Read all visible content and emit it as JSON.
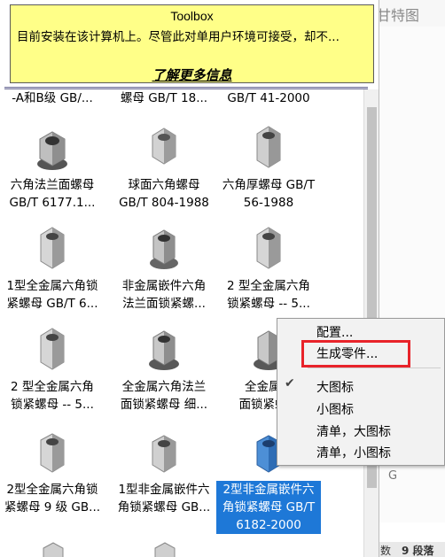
{
  "background_app": {
    "top_right_text": "甘特图",
    "side_letter": "G",
    "status_left": "数",
    "status_right": "9 段落"
  },
  "tooltip": {
    "title": "Toolbox",
    "description": "目前安装在该计算机上。尽管此对单用户环境可接受，却不...",
    "link": "了解更多信息"
  },
  "grid": {
    "items": [
      {
        "line1": "-A和B级 GB/...",
        "line2": ""
      },
      {
        "line1": "螺母 GB/T 18...",
        "line2": ""
      },
      {
        "line1": "GB/T 41-2000",
        "line2": ""
      },
      {
        "line1": "六角法兰面螺母",
        "line2": "GB/T 6177.1..."
      },
      {
        "line1": "球面六角螺母",
        "line2": "GB/T 804-1988"
      },
      {
        "line1": "六角厚螺母 GB/T",
        "line2": "56-1988"
      },
      {
        "line1": "1型全金属六角锁",
        "line2": "紧螺母 GB/T 6..."
      },
      {
        "line1": "非金属嵌件六角",
        "line2": "法兰面锁紧螺..."
      },
      {
        "line1": "2 型全金属六角",
        "line2": "锁紧螺母 -- 5..."
      },
      {
        "line1": "2 型全金属六角",
        "line2": "锁紧螺母 -- 5..."
      },
      {
        "line1": "全金属六角法兰",
        "line2": "面锁紧螺母 细..."
      },
      {
        "line1": "全金属六",
        "line2": "面锁紧螺..."
      },
      {
        "line1": "2型全金属六角锁",
        "line2": "紧螺母 9 级 GB..."
      },
      {
        "line1": "1型非金属嵌件六",
        "line2": "角锁紧螺母 GB..."
      },
      {
        "line1": "2型非金属嵌件六",
        "line2": "角锁紧螺母 GB/T",
        "line3": "6182-2000"
      }
    ]
  },
  "context_menu": {
    "items": [
      "配置...",
      "生成零件...",
      "大图标",
      "小图标",
      "清单，大图标",
      "清单，小图标"
    ],
    "checked": "大图标"
  },
  "colors": {
    "tooltip_bg": "#ffff88",
    "selection": "#1e78d7",
    "highlight_box": "#e8232a"
  }
}
